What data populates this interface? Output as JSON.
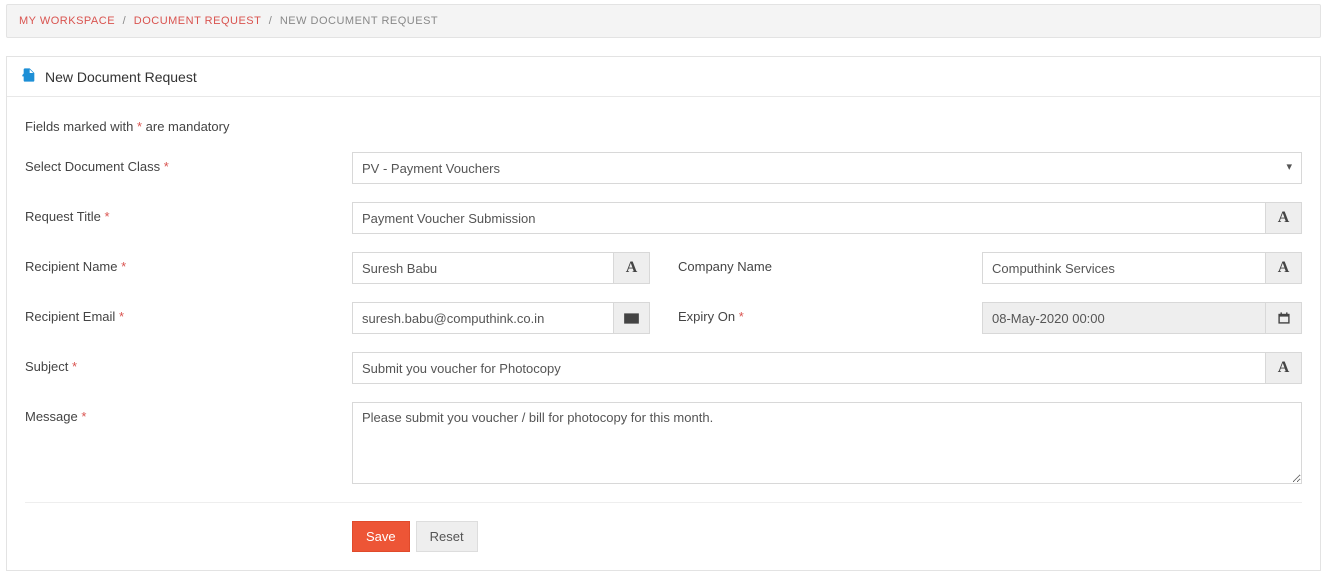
{
  "breadcrumb": {
    "items": [
      {
        "label": "MY WORKSPACE",
        "link": true
      },
      {
        "label": "DOCUMENT REQUEST",
        "link": true
      },
      {
        "label": "NEW DOCUMENT REQUEST",
        "link": false
      }
    ]
  },
  "panel": {
    "title": "New Document Request"
  },
  "note": {
    "prefix": "Fields marked with ",
    "suffix": " are mandatory"
  },
  "labels": {
    "document_class": "Select Document Class",
    "request_title": "Request Title",
    "recipient_name": "Recipient Name",
    "company_name": "Company Name",
    "recipient_email": "Recipient Email",
    "expiry_on": "Expiry On",
    "subject": "Subject",
    "message": "Message"
  },
  "values": {
    "document_class": "PV - Payment Vouchers",
    "request_title": "Payment Voucher Submission",
    "recipient_name": "Suresh Babu",
    "company_name": "Computhink Services",
    "recipient_email": "suresh.babu@computhink.co.in",
    "expiry_on": "08-May-2020 00:00",
    "subject": "Submit you voucher for Photocopy",
    "message": "Please submit you voucher / bill for photocopy for this month."
  },
  "buttons": {
    "save": "Save",
    "reset": "Reset"
  },
  "icons": {
    "font_addon": "A"
  }
}
